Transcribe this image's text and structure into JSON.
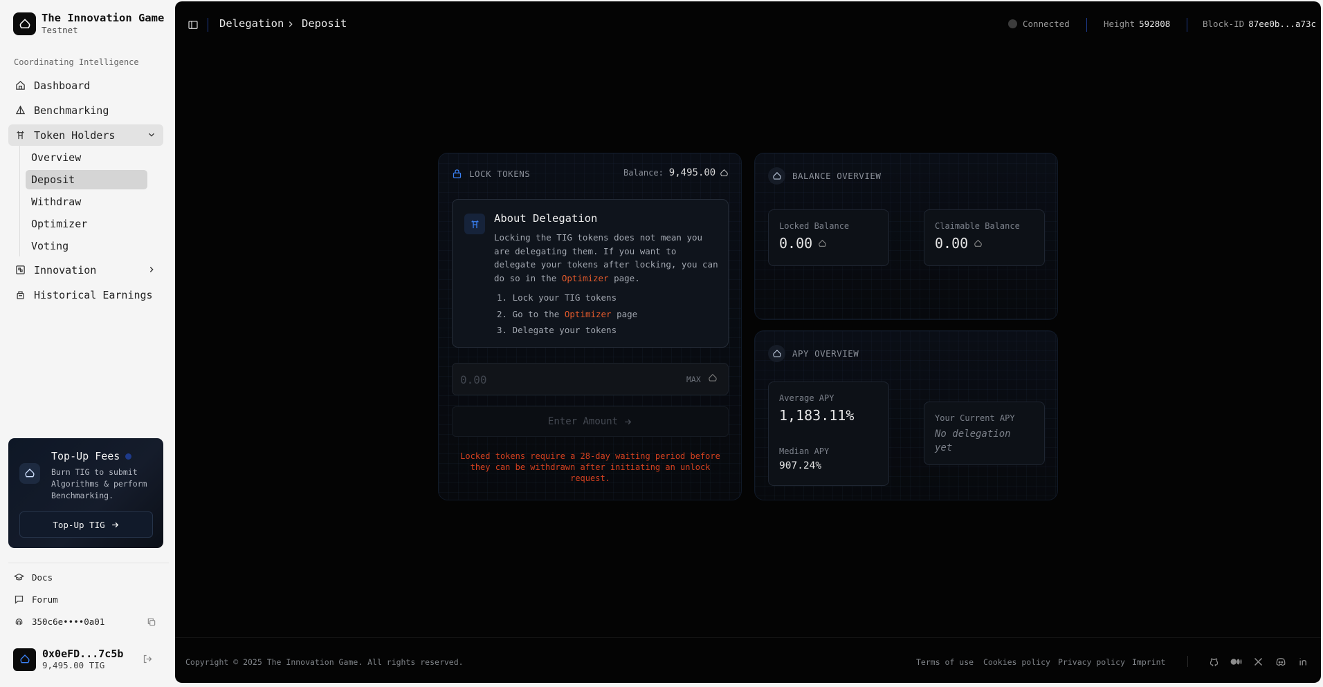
{
  "brand": {
    "name": "The Innovation Game",
    "network": "Testnet"
  },
  "sidebar": {
    "section_label": "Coordinating Intelligence",
    "nav": {
      "dashboard": "Dashboard",
      "benchmarking": "Benchmarking",
      "token_holders": "Token Holders",
      "innovation": "Innovation",
      "historical_earnings": "Historical Earnings"
    },
    "token_holders_sub": {
      "overview": "Overview",
      "deposit": "Deposit",
      "withdraw": "Withdraw",
      "optimizer": "Optimizer",
      "voting": "Voting"
    },
    "active_item": "Deposit",
    "topup": {
      "title": "Top-Up Fees",
      "description": "Burn TIG to submit Algorithms & perform Benchmarking.",
      "button": "Top-Up TIG"
    },
    "footer": {
      "docs": "Docs",
      "forum": "Forum",
      "api_key": "350c6e••••0a01"
    },
    "user": {
      "address": "0x0eFD...7c5b",
      "balance": "9,495.00 TIG"
    }
  },
  "header": {
    "breadcrumb": [
      "Delegation",
      "Deposit"
    ],
    "connection": "Connected",
    "height_label": "Height",
    "height_value": "592808",
    "block_label": "Block-ID",
    "block_value": "87ee0b...a73c"
  },
  "lock_card": {
    "title": "LOCK TOKENS",
    "balance_label": "Balance:",
    "balance_value": "9,495.00",
    "about": {
      "title": "About Delegation",
      "text_before": "Locking the TIG tokens does not mean you are delegating them. If you want to delegate your tokens after locking, you can do so in the",
      "text_link": "Optimizer",
      "text_after": "page.",
      "steps": {
        "step1": "Lock your TIG tokens",
        "step2_before": "Go to the",
        "step2_link": "Optimizer",
        "step2_after": "page",
        "step3": "Delegate your tokens"
      }
    },
    "amount_placeholder": "0.00",
    "max_label": "MAX",
    "submit_label": "Enter Amount",
    "warning": "Locked tokens require a 28-day waiting period before they can be withdrawn after initiating an unlock request."
  },
  "balance_card": {
    "title": "BALANCE OVERVIEW",
    "locked_label": "Locked Balance",
    "locked_value": "0.00",
    "claimable_label": "Claimable Balance",
    "claimable_value": "0.00"
  },
  "apy_card": {
    "title": "APY OVERVIEW",
    "average_label": "Average APY",
    "average_value": "1,183.11%",
    "median_label": "Median APY",
    "median_value": "907.24%",
    "current_label": "Your Current APY",
    "current_value": "No delegation yet"
  },
  "footer": {
    "copyright": "Copyright © 2025 The Innovation Game. All rights reserved.",
    "links": {
      "terms": "Terms of use",
      "cookies": "Cookies policy",
      "privacy": "Privacy policy",
      "imprint": "Imprint"
    },
    "social_icons": [
      "github-icon",
      "medium-icon",
      "x-icon",
      "discord-icon",
      "linkedin-icon"
    ]
  },
  "colors": {
    "accent_orange": "#e45a2c",
    "accent_blue": "#3b82f6",
    "warning_red": "#d2401f",
    "main_bg": "#040404"
  }
}
